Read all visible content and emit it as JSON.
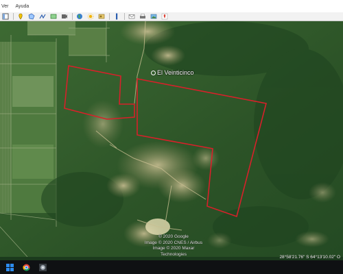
{
  "menu": {
    "items": [
      "Ver",
      "Ayuda"
    ]
  },
  "toolbar": {
    "icons": [
      "sidebar-icon",
      "placemark-icon",
      "polygon-icon",
      "path-icon",
      "overlay-icon",
      "tour-icon",
      "earth-icon",
      "sun-icon",
      "historical-imagery-icon",
      "ruler-icon",
      "email-icon",
      "print-icon",
      "save-image-icon",
      "maps-icon"
    ]
  },
  "map": {
    "place_label": "El Veinticinco",
    "credits": [
      "© 2020 Google",
      "Image © 2020 CNES / Airbus",
      "Image © 2020 Maxar Technologies"
    ],
    "coordinates": "28°58'21.76\" S    64°13'10.02\" O",
    "boundary_color": "#d8202a",
    "imagery_color": "#2f5a2a"
  },
  "taskbar": {
    "icons": [
      "windows-start-icon",
      "chrome-icon",
      "google-earth-icon"
    ]
  }
}
